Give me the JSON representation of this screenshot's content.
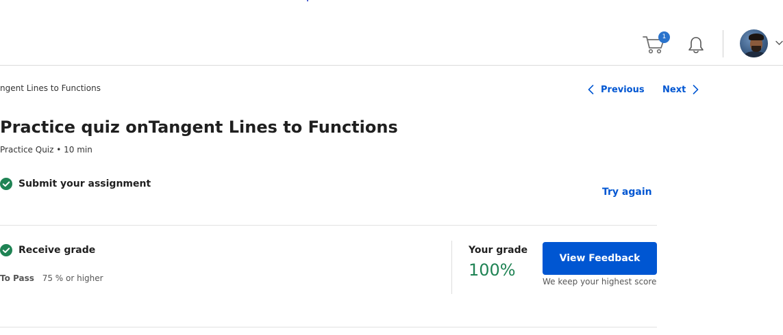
{
  "header": {
    "cart_count": "1",
    "colors": {
      "accent": "#0056d2",
      "badge": "#2a73cc"
    }
  },
  "breadcrumb": {
    "text": "ngent Lines to Functions"
  },
  "nav": {
    "previous_label": "Previous",
    "next_label": "Next"
  },
  "quiz": {
    "title": "Practice quiz onTangent Lines to Functions",
    "meta": "Practice Quiz • 10 min"
  },
  "submit": {
    "label": "Submit your assignment",
    "try_again_label": "Try again"
  },
  "receive": {
    "label": "Receive grade",
    "to_pass_label": "To Pass",
    "to_pass_value": "75 % or higher",
    "your_grade_label": "Your grade",
    "grade_value": "100%",
    "grade_color": "#1f8354",
    "view_feedback_label": "View Feedback",
    "keep_note": "We keep your highest score"
  }
}
